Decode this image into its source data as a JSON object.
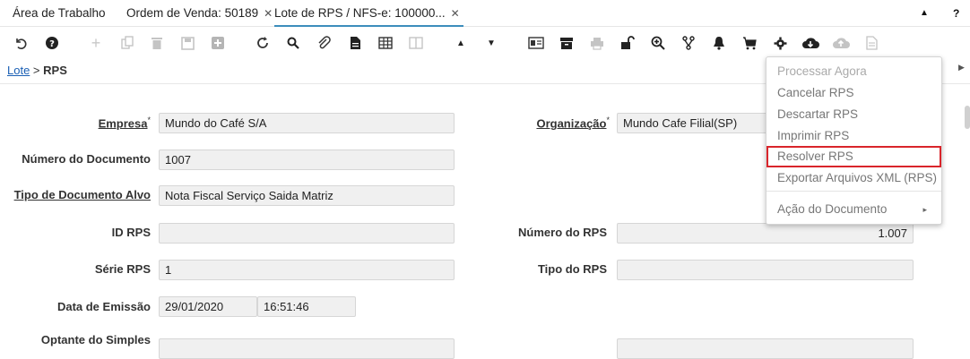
{
  "tabs": [
    {
      "label": "Área de Trabalho",
      "close": ""
    },
    {
      "label": "Ordem de Venda: 50189",
      "close": "✕"
    },
    {
      "label": "Lote de RPS / NFS-e: 100000...",
      "close": "✕"
    }
  ],
  "tabbar_controls": {
    "collapse": "▲",
    "help": "?"
  },
  "toolbar_icons": [
    "undo-icon",
    "help-icon",
    "new-record-icon",
    "copy-record-icon",
    "delete-icon",
    "save-icon",
    "save-new-icon",
    "refresh-icon",
    "search-icon",
    "attachment-icon",
    "document-icon",
    "grid-icon",
    "split-view-icon",
    "previous-record-icon",
    "next-record-icon",
    "report-icon",
    "archive-icon",
    "print-icon",
    "lock-icon",
    "zoom-icon",
    "workflow-icon",
    "notification-icon",
    "cart-icon",
    "process-gear-icon",
    "download-cloud-icon",
    "upload-cloud-icon",
    "file-icon"
  ],
  "breadcrumb": {
    "link": "Lote",
    "separator": " > ",
    "current": "RPS"
  },
  "form": {
    "empresa": {
      "label": "Empresa",
      "required": "*",
      "value": "Mundo do Café S/A"
    },
    "organizacao": {
      "label": "Organização",
      "required": "*",
      "value": "Mundo Cafe Filial(SP)"
    },
    "numero_documento": {
      "label": "Número do Documento",
      "value": "1007"
    },
    "tipo_documento_alvo": {
      "label": "Tipo de Documento Alvo",
      "value": "Nota Fiscal Serviço Saida Matriz"
    },
    "id_rps": {
      "label": "ID RPS",
      "value": ""
    },
    "numero_rps": {
      "label": "Número do RPS",
      "value": "1.007"
    },
    "serie_rps": {
      "label": "Série RPS",
      "value": "1"
    },
    "tipo_rps": {
      "label": "Tipo do RPS",
      "value": ""
    },
    "data_emissao": {
      "label": "Data de Emissão",
      "date": "29/01/2020",
      "time": "16:51:46"
    },
    "optante_simples": {
      "label": "Optante do Simples"
    }
  },
  "process_menu": {
    "items": [
      {
        "label": "Processar Agora"
      },
      {
        "label": "Cancelar RPS"
      },
      {
        "label": "Descartar RPS"
      },
      {
        "label": "Imprimir RPS"
      },
      {
        "label": "Resolver RPS"
      },
      {
        "label": "Exportar Arquivos XML (RPS)"
      },
      {
        "label": "Ação do Documento",
        "arrow": "▸"
      }
    ],
    "highlight_color": "#d9252b"
  }
}
